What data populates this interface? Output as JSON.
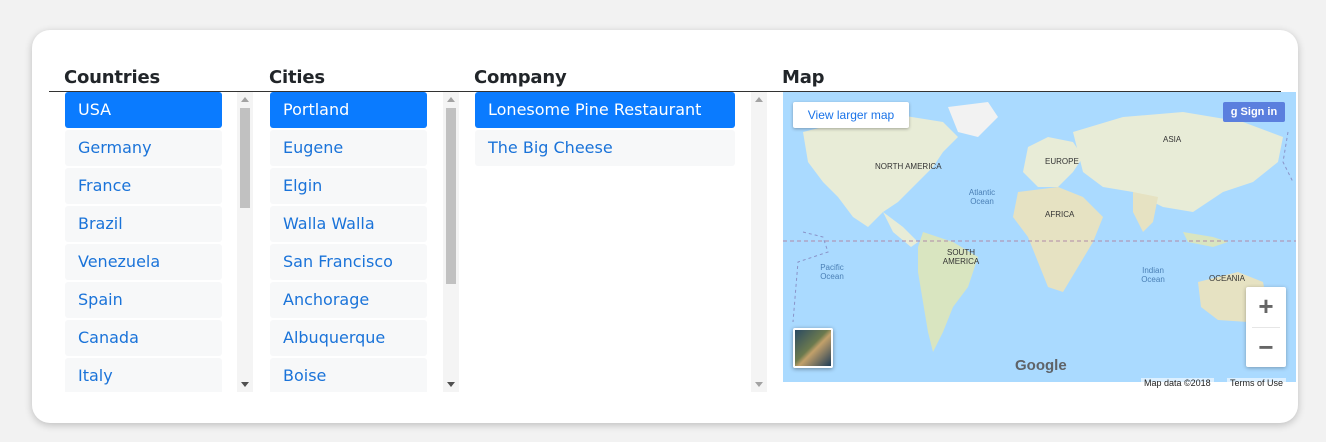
{
  "headers": {
    "countries": "Countries",
    "cities": "Cities",
    "company": "Company",
    "map": "Map"
  },
  "countries": [
    "USA",
    "Germany",
    "France",
    "Brazil",
    "Venezuela",
    "Spain",
    "Canada",
    "Italy"
  ],
  "cities": [
    "Portland",
    "Eugene",
    "Elgin",
    "Walla Walla",
    "San Francisco",
    "Anchorage",
    "Albuquerque",
    "Boise"
  ],
  "companies": [
    "Lonesome Pine Restaurant",
    "The Big Cheese"
  ],
  "map": {
    "view_larger": "View larger map",
    "sign_in": "Sign in",
    "zoom_in": "+",
    "zoom_out": "−",
    "labels": {
      "north_america": "NORTH AMERICA",
      "europe": "EUROPE",
      "asia": "ASIA",
      "africa": "AFRICA",
      "south_america": "SOUTH AMERICA",
      "oceania": "OCEANIA",
      "atlantic": "Atlantic Ocean",
      "pacific": "Pacific Ocean",
      "indian": "Indian Ocean"
    },
    "logo": "Google",
    "attribution": "Map data ©2018",
    "terms": "Terms of Use"
  },
  "colors": {
    "accent": "#0a7bff",
    "link": "#1a73d9",
    "water": "#aadaff",
    "land": "#e8ecd7"
  }
}
